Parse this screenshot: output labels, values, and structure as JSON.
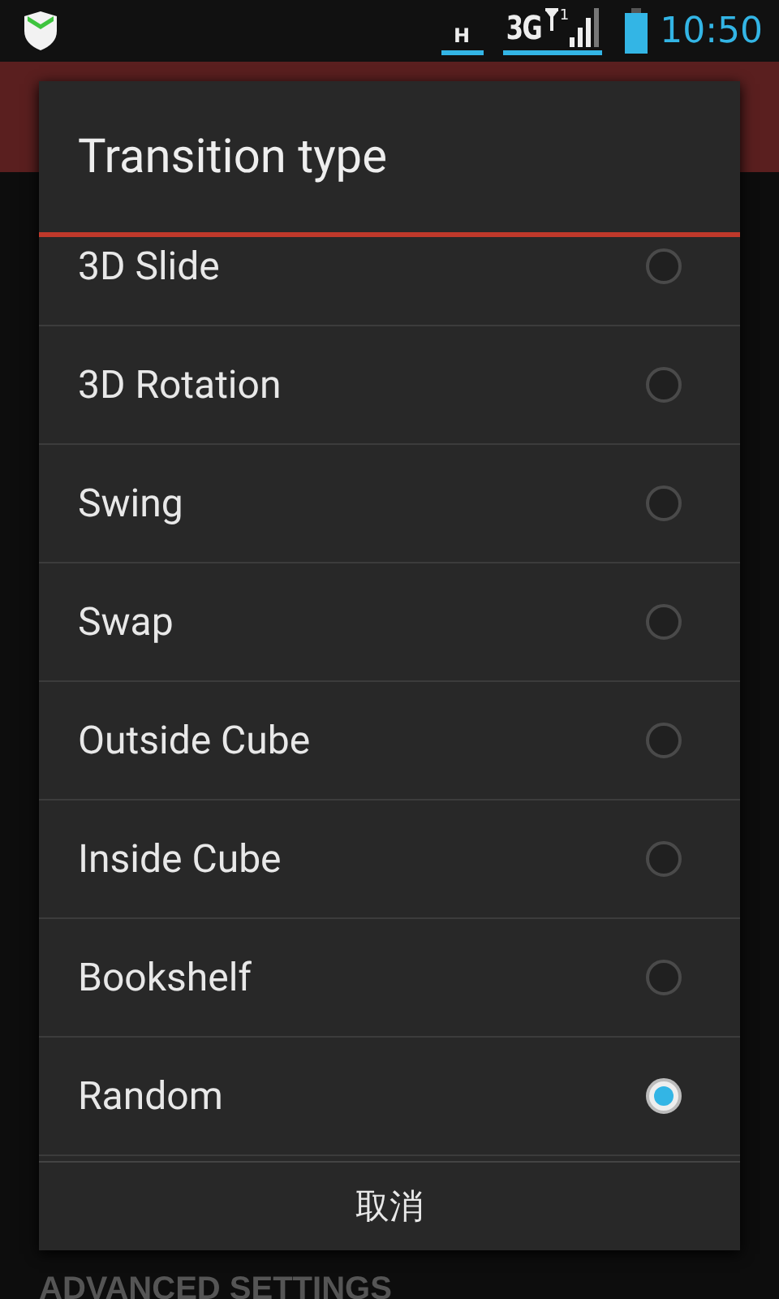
{
  "status_bar": {
    "data_indicator": "H",
    "network": "3G",
    "sim_slot": "1",
    "time": "10:50"
  },
  "background": {
    "section_heading": "ADVANCED SETTINGS"
  },
  "dialog": {
    "title": "Transition type",
    "options": [
      {
        "label": "3D Slide",
        "selected": false
      },
      {
        "label": "3D Rotation",
        "selected": false
      },
      {
        "label": "Swing",
        "selected": false
      },
      {
        "label": "Swap",
        "selected": false
      },
      {
        "label": "Outside Cube",
        "selected": false
      },
      {
        "label": "Inside Cube",
        "selected": false
      },
      {
        "label": "Bookshelf",
        "selected": false
      },
      {
        "label": "Random",
        "selected": true
      }
    ],
    "cancel_button": "取消"
  }
}
